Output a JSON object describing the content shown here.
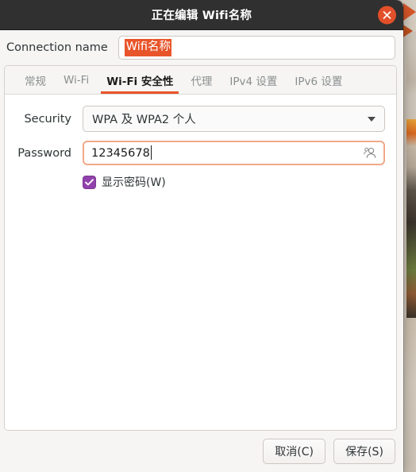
{
  "window": {
    "title": "正在编辑 Wifi名称",
    "close_icon": "close-icon"
  },
  "connection_name": {
    "label": "Connection name",
    "value": "Wifi名称",
    "selected": true,
    "selection_color": "#e8552a"
  },
  "tabs": [
    {
      "label": "常规",
      "active": false
    },
    {
      "label": "Wi-Fi",
      "active": false
    },
    {
      "label": "Wi-Fi 安全性",
      "active": true
    },
    {
      "label": "代理",
      "active": false
    },
    {
      "label": "IPv4 设置",
      "active": false
    },
    {
      "label": "IPv6 设置",
      "active": false
    }
  ],
  "tab_accent_color": "#e8552a",
  "security_section": {
    "security_label": "Security",
    "security_value": "WPA 及 WPA2 个人",
    "security_dropdown_icon": "chevron-down-icon",
    "password_label": "Password",
    "password_value": "12345678",
    "password_scope_icon": "person-icon",
    "password_focus_color": "#f0a988",
    "show_password_label": "显示密码(W)",
    "show_password_checked": true,
    "checkbox_color": "#9141ac"
  },
  "footer": {
    "cancel_label": "取消(C)",
    "save_label": "保存(S)"
  }
}
